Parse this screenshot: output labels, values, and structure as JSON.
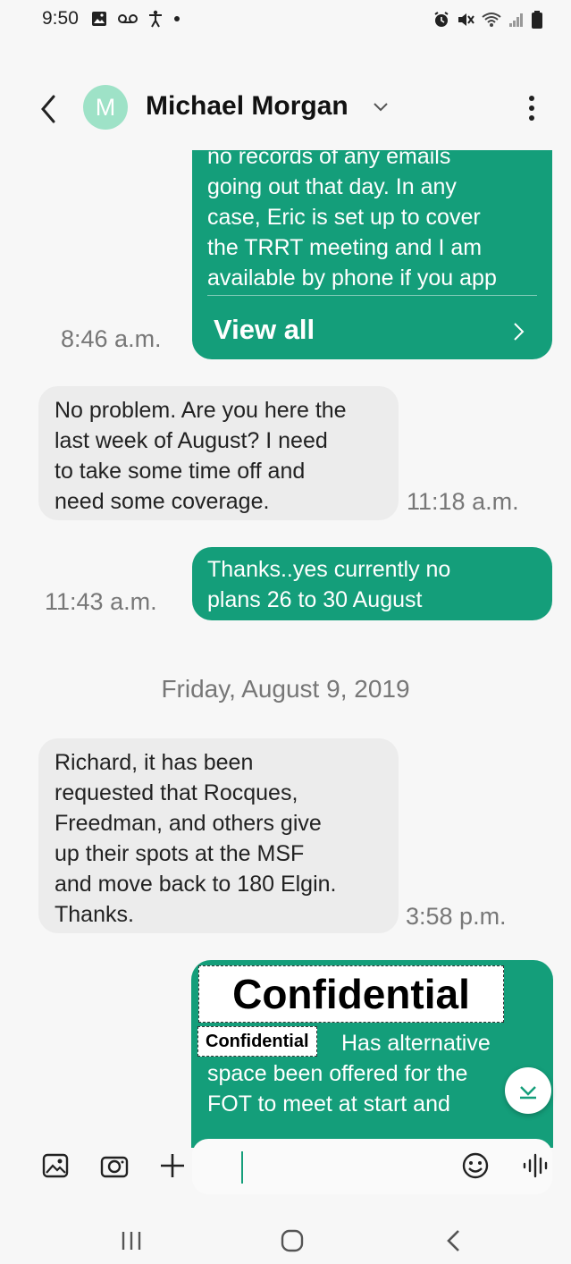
{
  "status_bar": {
    "time": "9:50"
  },
  "header": {
    "avatar_initial": "M",
    "contact_name": "Michael Morgan"
  },
  "messages": [
    {
      "direction": "outgoing",
      "text": "no records of any emails\ngoing out that day. In any\ncase, Eric is set up to cover\nthe TRRT meeting and I am\navailable by phone if you app",
      "action_label": "View all",
      "time": "8:46 a.m."
    },
    {
      "direction": "incoming",
      "text": "No problem. Are you here the\nlast week of August? I need\nto take some time off and\nneed some coverage.",
      "time": "11:18 a.m."
    },
    {
      "direction": "outgoing",
      "text": "Thanks..yes currently no\nplans 26 to 30 August",
      "time": "11:43 a.m."
    },
    {
      "direction": "incoming",
      "text": "Richard, it has been\nrequested that Rocques,\nFreedman, and others give\nup their spots at the MSF\nand move back to 180 Elgin.\nThanks.",
      "time": "3:58 p.m."
    },
    {
      "direction": "outgoing",
      "text": "Has alternative\nspace been offered for the\nFOT to meet at start and",
      "redaction_label_large": "Confidential",
      "redaction_label_small": "Confidential"
    }
  ],
  "date_separator": "Friday, August 9, 2019",
  "composer": {
    "placeholder": ""
  },
  "colors": {
    "outgoing_bubble": "#149e7a",
    "incoming_bubble": "#ececec",
    "avatar": "#9ee2c7"
  }
}
